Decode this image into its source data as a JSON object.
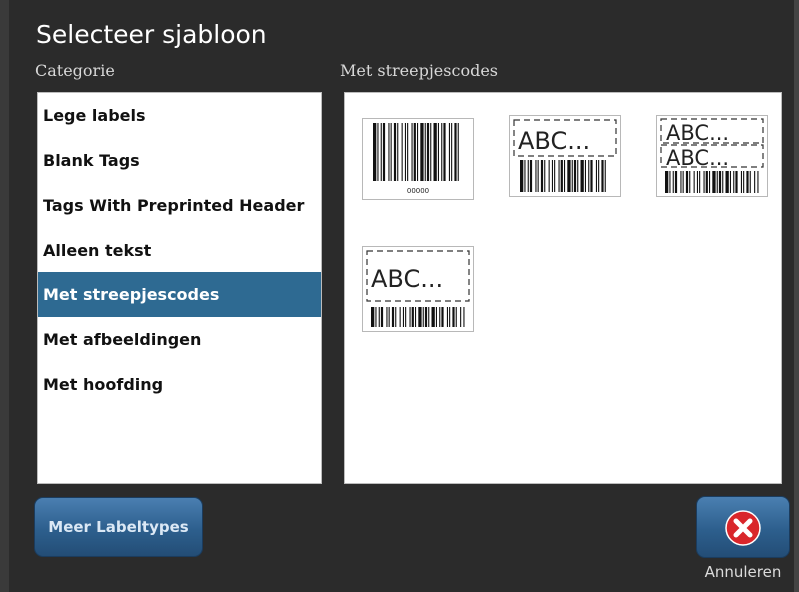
{
  "window": {
    "title": "Selecteer sjabloon"
  },
  "category_panel": {
    "label": "Categorie",
    "items": [
      {
        "label": "Lege labels"
      },
      {
        "label": "Blank Tags"
      },
      {
        "label": "Tags With Preprinted Header"
      },
      {
        "label": "Alleen tekst"
      },
      {
        "label": "Met streepjescodes",
        "selected": true
      },
      {
        "label": "Met afbeeldingen"
      },
      {
        "label": "Met hoofding"
      }
    ]
  },
  "template_panel": {
    "label": "Met streepjescodes",
    "templates": [
      {
        "type": "barcode-only",
        "human_readable": "00000"
      },
      {
        "type": "text-field-over-barcode",
        "field_text": "ABC..."
      },
      {
        "type": "two-text-fields-over-barcode",
        "field_text": "ABC...",
        "field_text_2": "ABC..."
      },
      {
        "type": "text-field-over-barcode",
        "field_text": "ABC..."
      }
    ]
  },
  "buttons": {
    "more_label": "Meer Labeltypes",
    "cancel_label": "Annuleren",
    "cancel_icon": "close-x-icon"
  },
  "colors": {
    "background": "#2b2b2b",
    "selection": "#2e6a92",
    "button": "#2d5f8d",
    "cancel_icon": "#d9262b"
  }
}
